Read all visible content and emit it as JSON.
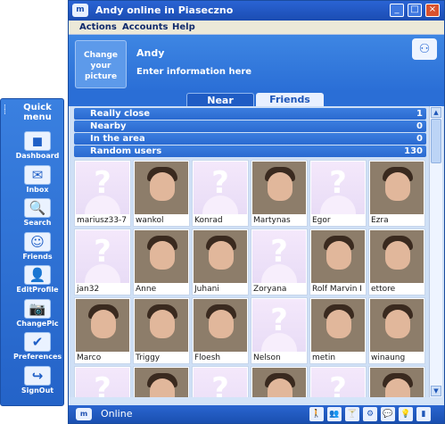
{
  "quick_menu": {
    "title": "Quick\nmenu",
    "items": [
      {
        "label": "Dashboard",
        "icon": "dashboard-icon",
        "glyph": "◼"
      },
      {
        "label": "Inbox",
        "icon": "envelope-icon",
        "glyph": "✉"
      },
      {
        "label": "Search",
        "icon": "search-icon",
        "glyph": "🔍"
      },
      {
        "label": "Friends",
        "icon": "friends-icon",
        "glyph": "☺"
      },
      {
        "label": "EditProfile",
        "icon": "profile-icon",
        "glyph": "👤"
      },
      {
        "label": "ChangePic",
        "icon": "camera-icon",
        "glyph": "📷"
      },
      {
        "label": "Preferences",
        "icon": "checkmark-icon",
        "glyph": "✔"
      },
      {
        "label": "SignOut",
        "icon": "signout-icon",
        "glyph": "↪"
      }
    ]
  },
  "window": {
    "title": "Andy online in Piaseczno",
    "menu": [
      "Actions",
      "Accounts",
      "Help"
    ]
  },
  "profile": {
    "change_picture_label": "Change your picture",
    "name": "Andy",
    "info": "Enter information here"
  },
  "tabs": [
    {
      "label": "Near",
      "active": true
    },
    {
      "label": "Friends",
      "active": false
    }
  ],
  "categories": [
    {
      "label": "Really close",
      "count": "1"
    },
    {
      "label": "Nearby",
      "count": "0"
    },
    {
      "label": "In the area",
      "count": "0"
    },
    {
      "label": "Random users",
      "count": "130"
    }
  ],
  "users": [
    {
      "name": "mariusz33-7",
      "photo": false
    },
    {
      "name": "wankol",
      "photo": true
    },
    {
      "name": "Konrad",
      "photo": false
    },
    {
      "name": "Martynas",
      "photo": true
    },
    {
      "name": "Egor",
      "photo": false
    },
    {
      "name": "Ezra",
      "photo": true
    },
    {
      "name": "jan32",
      "photo": false
    },
    {
      "name": "Anne",
      "photo": true
    },
    {
      "name": "Juhani",
      "photo": true
    },
    {
      "name": "Zoryana",
      "photo": false
    },
    {
      "name": "Rolf Marvin I",
      "photo": true
    },
    {
      "name": "ettore",
      "photo": true
    },
    {
      "name": "Marco",
      "photo": true
    },
    {
      "name": "Triggy",
      "photo": true
    },
    {
      "name": "Floesh",
      "photo": true
    },
    {
      "name": "Nelson",
      "photo": false
    },
    {
      "name": "metin",
      "photo": true
    },
    {
      "name": "winaung",
      "photo": true
    },
    {
      "name": "",
      "photo": false
    },
    {
      "name": "",
      "photo": true
    },
    {
      "name": "",
      "photo": false
    },
    {
      "name": "",
      "photo": true
    },
    {
      "name": "",
      "photo": false
    },
    {
      "name": "",
      "photo": true
    }
  ],
  "status": {
    "text": "Online",
    "tray": [
      "person-icon",
      "people-icon",
      "cocktail-icon",
      "gear-icon",
      "chat-icon",
      "bulb-icon",
      "signal-icon"
    ]
  }
}
